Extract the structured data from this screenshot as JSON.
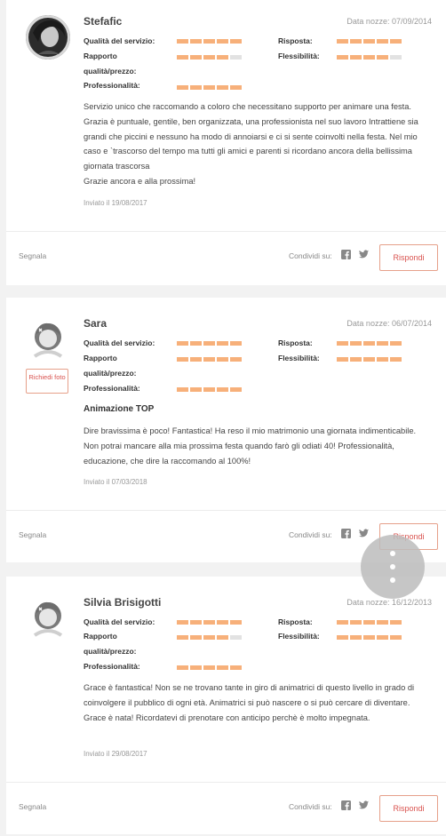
{
  "labels": {
    "quality": "Qualità del servizio:",
    "ratio1": "Rapporto",
    "ratio2": "qualità/prezzo:",
    "pro": "Professionalità:",
    "response": "Risposta:",
    "flex": "Flessibilità:",
    "segnala": "Segnala",
    "share": "Condividi su:",
    "reply": "Rispondi",
    "request_photo": "Richiedi foto"
  },
  "colors": {
    "rating_on": "#f7b07a",
    "rating_off": "#e2e2e2",
    "accent": "#d9534f"
  },
  "reviews": [
    {
      "name": "Stefafic",
      "date": "Data nozze: 07/09/2014",
      "ratings": {
        "quality": 5,
        "ratio": 4,
        "pro": 5,
        "response": 5,
        "flex": 4
      },
      "title": "",
      "body": "Servizio unico che raccomando a coloro che necessitano supporto per animare una festa. Grazia è puntuale, gentile, ben organizzata, una professionista nel suo lavoro Intrattiene sia grandi che piccini e nessuno ha modo di annoiarsi e ci si sente coinvolti nella festa. Nel mio caso e `trascorso del tempo ma tutti gli amici e parenti si ricordano ancora della bellissima giornata trascorsa\nGrazie ancora e alla prossima!",
      "sent": "Inviato il 19/08/2017"
    },
    {
      "name": "Sara",
      "date": "Data nozze: 06/07/2014",
      "ratings": {
        "quality": 5,
        "ratio": 5,
        "pro": 5,
        "response": 5,
        "flex": 5
      },
      "title": "Animazione TOP",
      "body": "Dire bravissima è poco! Fantastica! Ha reso il mio matrimonio una giornata indimenticabile. Non potrai mancare alla mia prossima festa quando farò gli odiati 40! Professionalità, educazione, che dire la raccomando al 100%!",
      "sent": "Inviato il 07/03/2018"
    },
    {
      "name": "Silvia Brisigotti",
      "date": "Data nozze: 16/12/2013",
      "ratings": {
        "quality": 5,
        "ratio": 4,
        "pro": 5,
        "response": 5,
        "flex": 5
      },
      "title": "",
      "body": "Grace è fantastica! Non se ne trovano tante in giro di animatrici di questo livello in grado di coinvolgere il pubblico di ogni età. Animatrici si può nascere o si può cercare di diventare. Grace è nata! Ricordatevi di prenotare con anticipo perchè è molto impegnata.",
      "sent": "Inviato il 29/08/2017"
    }
  ]
}
